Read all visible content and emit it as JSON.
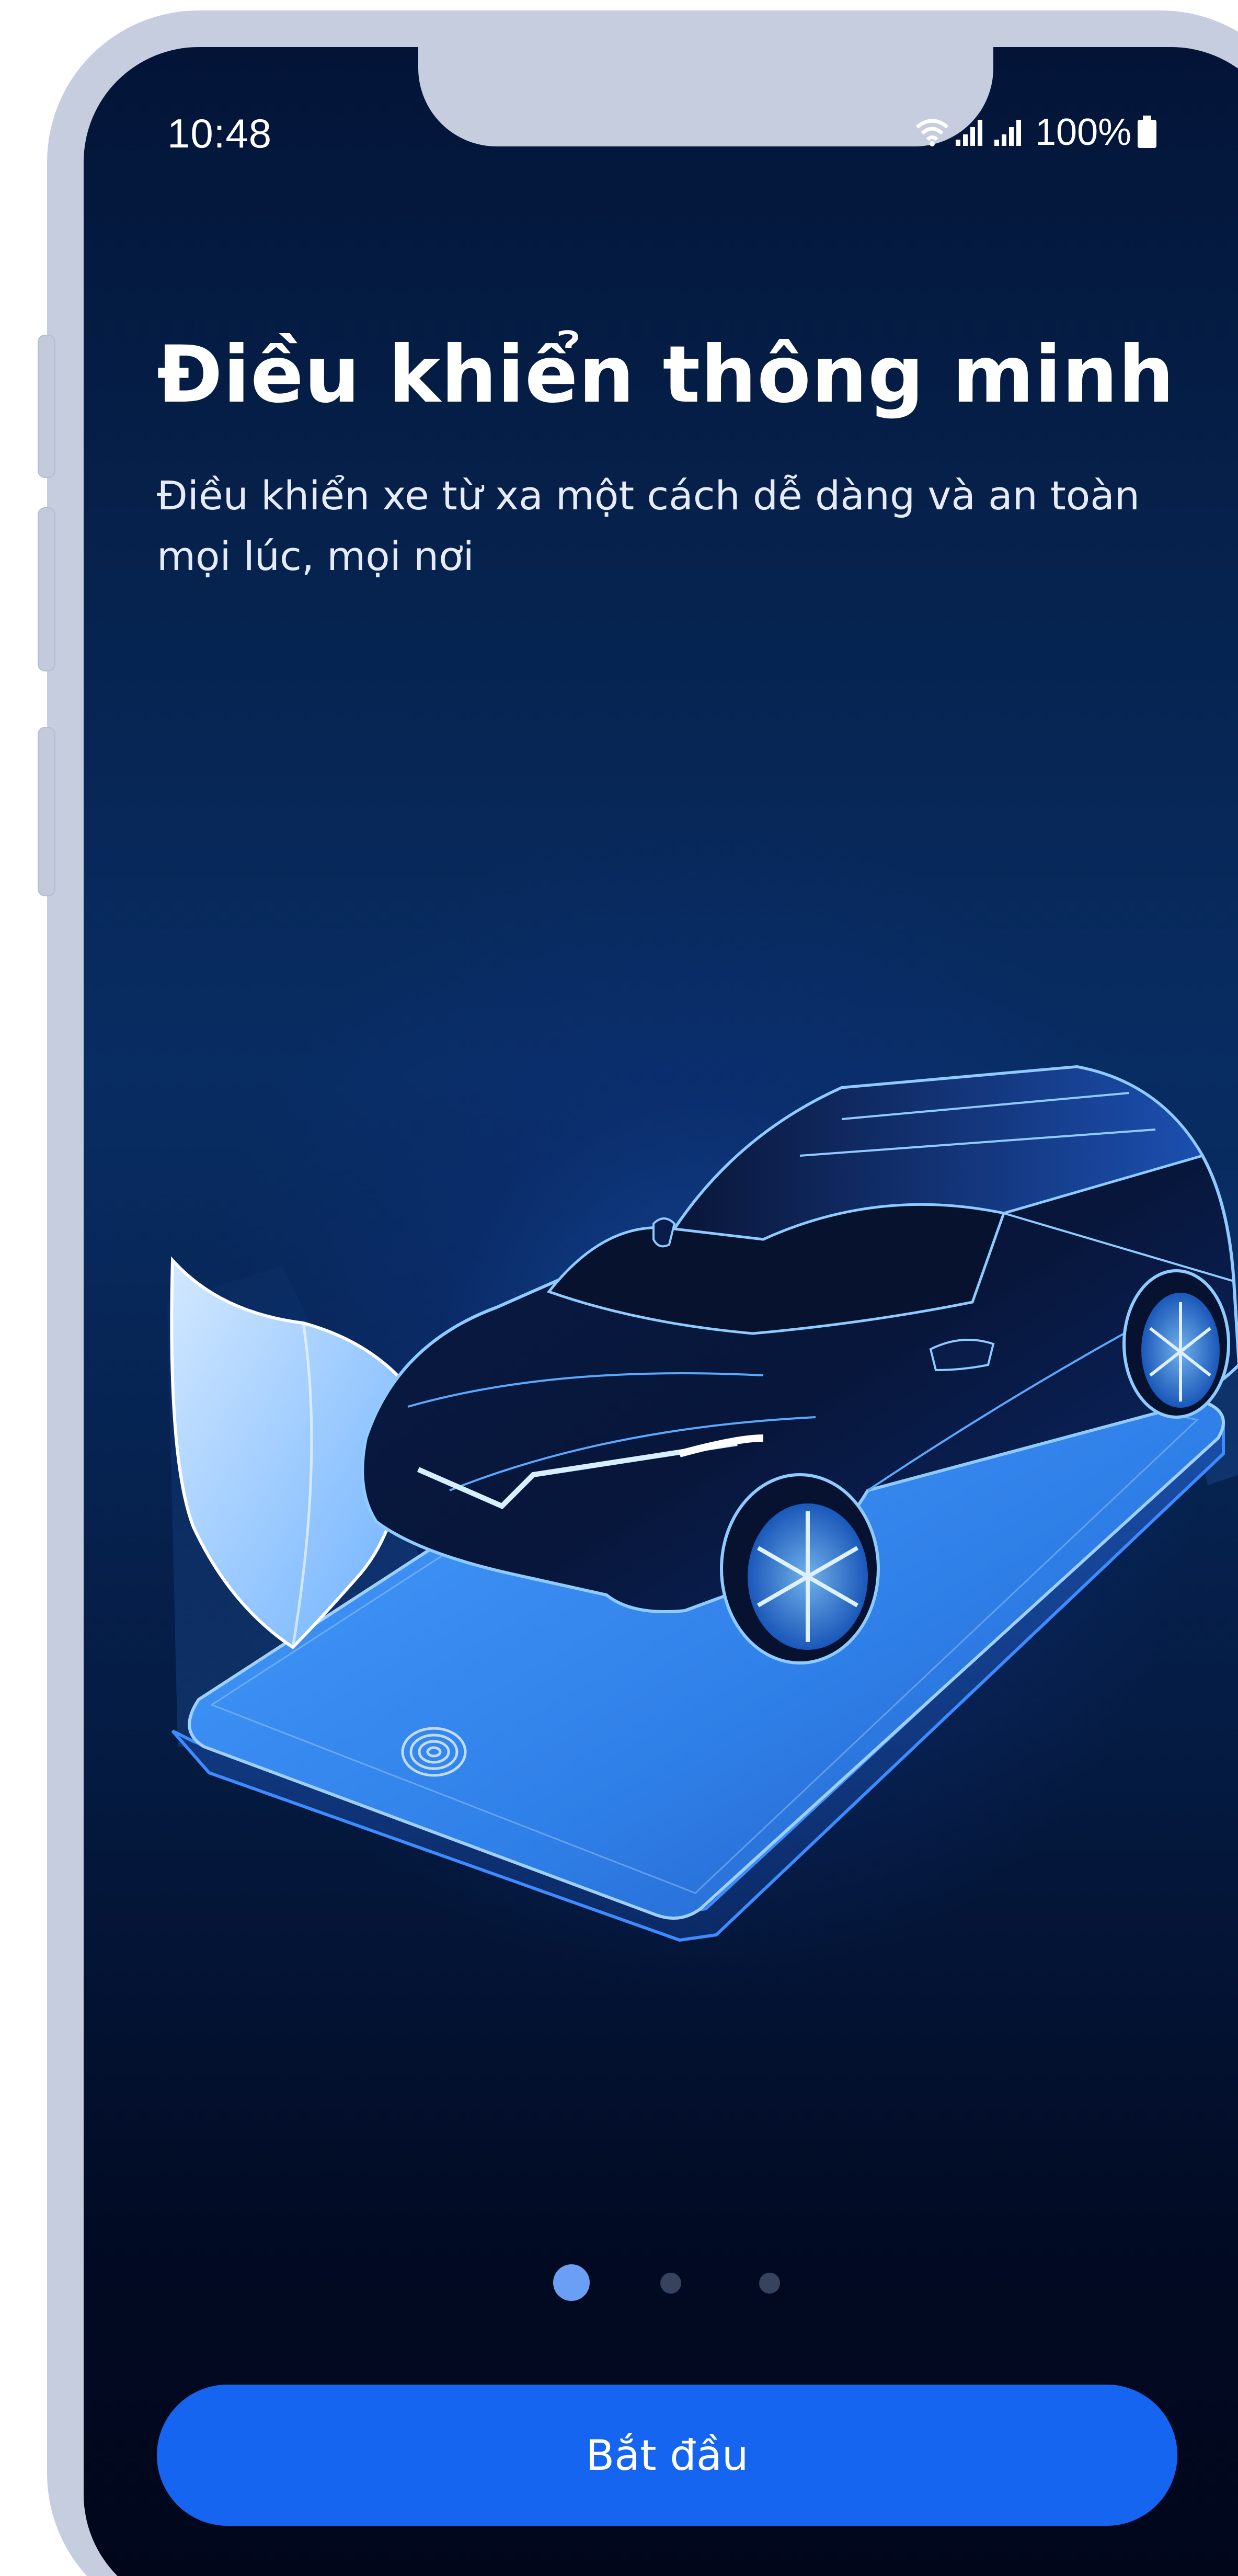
{
  "status_bar": {
    "time": "10:48",
    "battery": "100%",
    "icons": [
      "wifi-icon",
      "signal-icon",
      "signal-icon",
      "battery-icon"
    ]
  },
  "onboarding": {
    "title": "Điều khiển thông minh",
    "subtitle": "Điều khiển xe từ xa một cách dễ dàng và an toàn mọi lúc, mọi nơi",
    "illustration_icons": [
      "car-icon",
      "shield-icon",
      "fingerprint-icon",
      "phone-icon"
    ],
    "pagination": {
      "total": 3,
      "active_index": 0
    }
  },
  "cta": {
    "label": "Bắt đầu"
  },
  "colors": {
    "background_top": "#031437",
    "background_bottom": "#01061a",
    "accent": "#1565f0",
    "dot_active": "#6b9ff5",
    "dot_inactive": "#36435f",
    "frame": "#c6cddf"
  }
}
